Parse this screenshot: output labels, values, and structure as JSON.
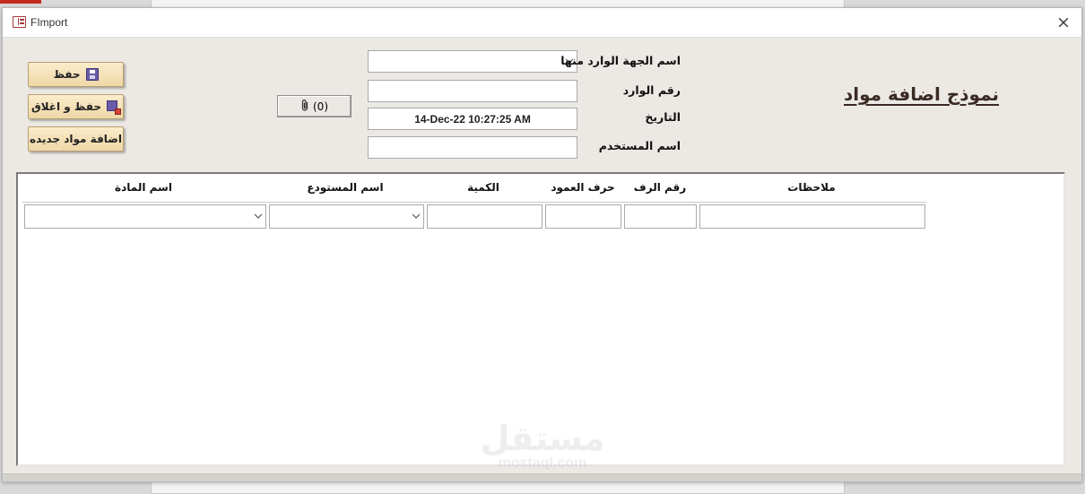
{
  "window": {
    "title": "FImport",
    "close_label": "×"
  },
  "buttons": {
    "save": "حفظ",
    "save_close": "حفظ و اغلاق",
    "add_new": "اضافة مواد جديده",
    "attachments": "(0)"
  },
  "form": {
    "title": "نموذج اضافة مواد",
    "source_label": "اسم الجهة الوارد منها",
    "source_value": "",
    "incoming_no_label": "رقم الوارد",
    "incoming_no_value": "",
    "date_label": "التاريخ",
    "date_value": "14-Dec-22 10:27:25 AM",
    "user_label": "اسم المستخدم",
    "user_value": ""
  },
  "subform": {
    "columns": {
      "notes": "ملاحظات",
      "shelf_no": "رقم الرف",
      "column_letter": "حرف العمود",
      "quantity": "الكمية",
      "warehouse": "اسم المستودع",
      "item_name": "اسم المادة"
    }
  },
  "watermark": {
    "main": "مستقل",
    "sub": "mostaql.com"
  },
  "icons": {
    "save": "save-disk-icon",
    "save_close": "save-close-icon",
    "attach": "paperclip-icon",
    "form": "form-icon",
    "combo": "chevron-down-icon"
  },
  "colors": {
    "button_fill": "#f5e2b8",
    "title_text": "#3b2a24",
    "window_bg": "#ece9e4"
  }
}
